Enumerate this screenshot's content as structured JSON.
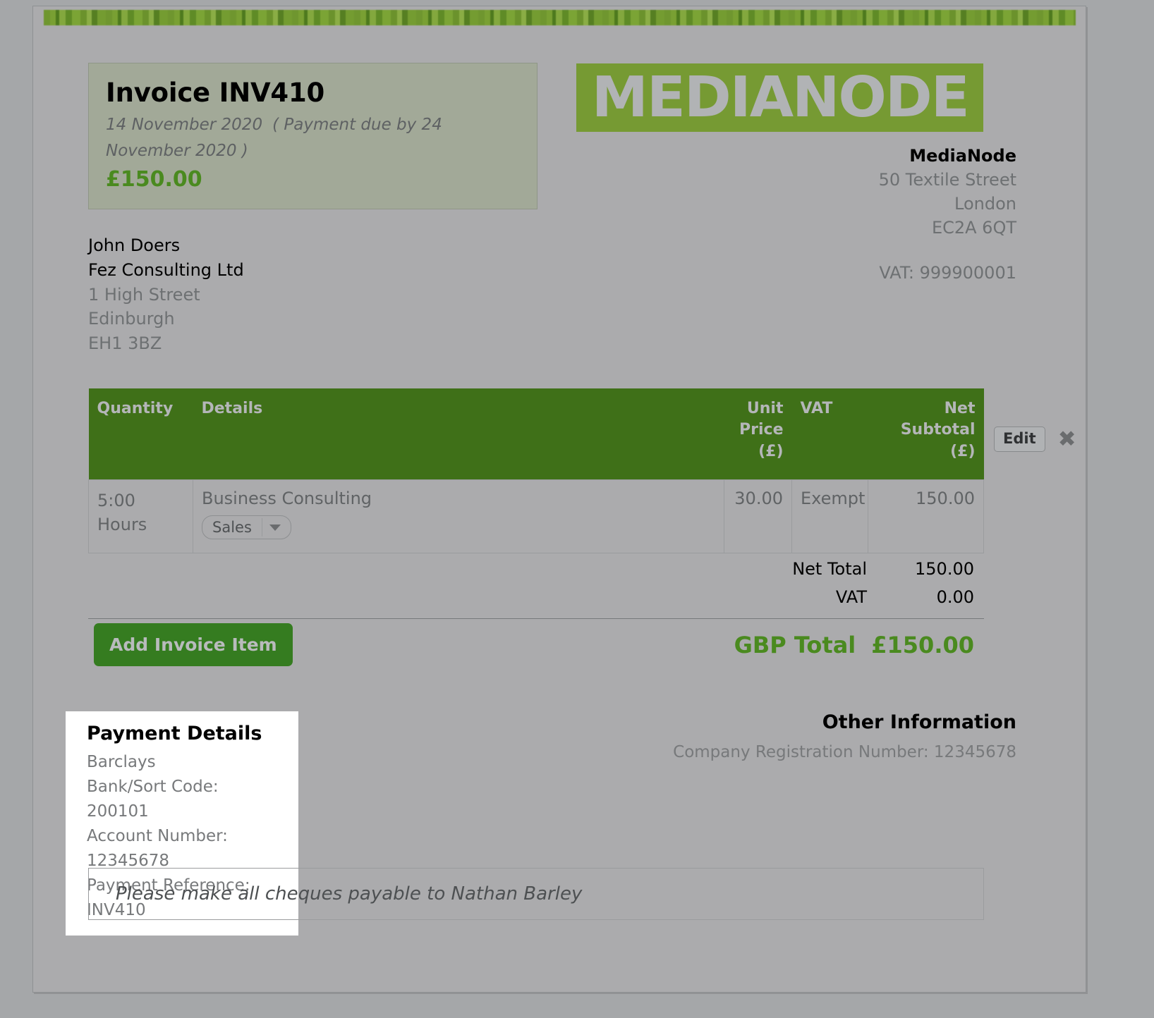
{
  "invoice": {
    "title": "Invoice INV410",
    "issue_date": "14 November 2020",
    "due_note": "( Payment due by 24 November 2020 )",
    "amount": "£150.00"
  },
  "logo": {
    "text": "MEDIANODE",
    "banner_color": "#769a33"
  },
  "supplier": {
    "name": "MediaNode",
    "street": "50 Textile Street",
    "city": "London",
    "postcode": "EC2A 6QT",
    "vat": "VAT: 999900001"
  },
  "customer": {
    "contact": "John Doers",
    "company": "Fez Consulting Ltd",
    "street": "1 High Street",
    "city": "Edinburgh",
    "postcode": "EH1 3BZ"
  },
  "table": {
    "headers": {
      "quantity": "Quantity",
      "details": "Details",
      "unit_price": "Unit Price (£)",
      "vat": "VAT",
      "net_subtotal": "Net Subtotal (£)"
    },
    "header_color": "#3f7018",
    "rows": [
      {
        "quantity": "5:00 Hours",
        "details": "Business Consulting",
        "category": "Sales",
        "unit_price": "30.00",
        "vat": "Exempt",
        "net_subtotal": "150.00",
        "edit_label": "Edit",
        "delete_label": "✖"
      }
    ]
  },
  "totals": {
    "net_total_label": "Net Total",
    "net_total_value": "150.00",
    "vat_label": "VAT",
    "vat_value": "0.00",
    "grand_label": "GBP Total",
    "grand_value": "£150.00",
    "grand_color": "#4a8a1f"
  },
  "actions": {
    "add_item_label": "Add Invoice Item"
  },
  "payment_details": {
    "heading": "Payment Details",
    "bank": "Barclays",
    "sort_code": "Bank/Sort Code: 200101",
    "account_number": "Account Number: 12345678",
    "reference": "Payment Reference: INV410"
  },
  "other_information": {
    "heading": "Other Information",
    "company_registration": "Company Registration Number: 12345678"
  },
  "footer": {
    "note": "Please make all cheques payable to Nathan Barley"
  }
}
